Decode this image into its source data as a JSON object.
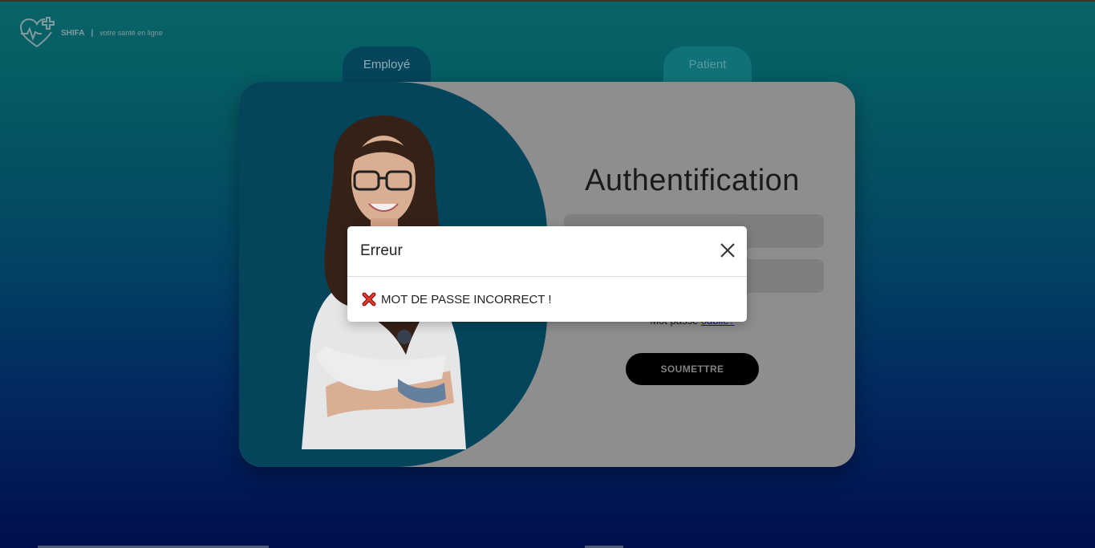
{
  "logo": {
    "brand": "SHIFA",
    "separator": "|",
    "tagline": "votre santé en ligne",
    "icon": "heart-pulse-cross-icon"
  },
  "tabs": [
    {
      "label": "Employé",
      "active": true
    },
    {
      "label": "Patient",
      "active": false
    }
  ],
  "login": {
    "title": "Authentification",
    "username_placeholder": "",
    "password_placeholder": "",
    "forgot_prefix": "Mot passe",
    "forgot_link": "oublié?",
    "submit_label": "SOUMETTRE"
  },
  "modal": {
    "title": "Erreur",
    "message_icon": "red-x-icon",
    "message": "MOT DE PASSE INCORRECT !"
  },
  "colors": {
    "accent": "#054a62",
    "error": "#d12c2c",
    "submit_bg": "#000000"
  }
}
